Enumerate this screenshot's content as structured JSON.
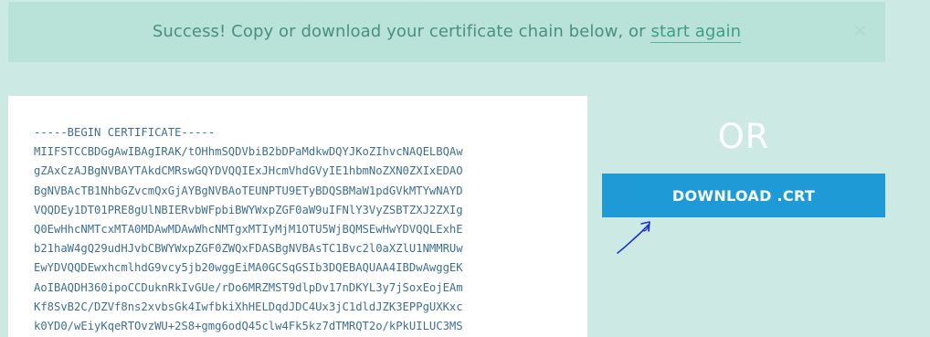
{
  "alert": {
    "message": "Success! Copy or download your certificate chain below, or ",
    "link_text": "start again",
    "close_glyph": "×"
  },
  "certificate": {
    "lines": [
      "-----BEGIN CERTIFICATE-----",
      "MIIFSTCCBDGgAwIBAgIRAK/tOHhmSQDVbiB2bDPaMdkwDQYJKoZIhvcNAQELBQAw",
      "gZAxCzAJBgNVBAYTAkdCMRswGQYDVQQIExJHcmVhdGVyIE1hbmNoZXN0ZXIxEDAO",
      "BgNVBAcTB1NhbGZvcmQxGjAYBgNVBAoTEUNPTU9ETyBDQSBMaW1pdGVkMTYwNAYD",
      "VQQDEy1DT01PRE8gUlNBIERvbWFpbiBWYWxpZGF0aW9uIFNlY3VyZSBTZXJ2ZXIg",
      "Q0EwHhcNMTcxMTA0MDAwMDAwWhcNMTgxMTIyMjM1OTU5WjBQMSEwHwYDVQQLExhE",
      "b21haW4gQ29udHJvbCBWYWxpZGF0ZWQxFDASBgNVBAsTC1Bvc2l0aXZlU1NMMRUw",
      "EwYDVQQDEwxhcmlhdG9vcy5jb20wggEiMA0GCSqGSIb3DQEBAQUAA4IBDwAwggEK",
      "AoIBAQDH360ipoCCDuknRkIvGUe/rDo6MRZMST9dlpDv17nDKYL3y7jSoxEojEAm",
      "Kf8SvB2C/DZVf8ns2xvbsGk4IwfbkiXhHELDqdJDC4Ux3jC1dldJZK3EPPgUXKxc",
      "k0YD0/wEiyKqeRTOvzWU+2S8+gmg6odQ45clw4Fk5kz7dTMRQT2o/kPkUILUC3MS"
    ]
  },
  "or_label": "OR",
  "download": {
    "label": "DOWNLOAD .CRT"
  },
  "colors": {
    "background": "#cde9e3",
    "alert_background": "#b9e2d9",
    "alert_text": "#4a8f7f",
    "button": "#1e9bd7",
    "cert_text": "#3f6f8f",
    "annotation": "#1a2fd6"
  },
  "icons": {
    "close": "close-icon",
    "annotation": "hand-drawn-arrow-icon"
  }
}
